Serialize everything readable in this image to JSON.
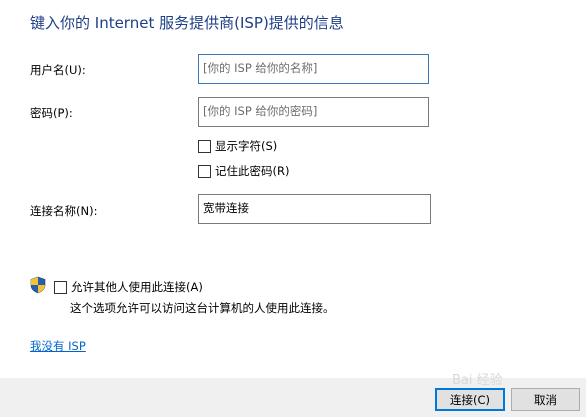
{
  "header": {
    "title": "键入你的 Internet 服务提供商(ISP)提供的信息"
  },
  "form": {
    "username_label": "用户名(U):",
    "username_placeholder": "[你的 ISP 给你的名称]",
    "password_label": "密码(P):",
    "password_placeholder": "[你的 ISP 给你的密码]",
    "show_chars_label": "显示字符(S)",
    "remember_password_label": "记住此密码(R)",
    "connection_name_label": "连接名称(N):",
    "connection_name_value": "宽带连接"
  },
  "sharing": {
    "shield_icon": "uac-shield-icon",
    "allow_others_label": "允许其他人使用此连接(A)",
    "allow_others_description": "这个选项允许可以访问这台计算机的人使用此连接。"
  },
  "links": {
    "no_isp": "我没有 ISP"
  },
  "footer": {
    "connect_label": "连接(C)",
    "cancel_label": "取消"
  },
  "watermark": {
    "text": "Bai 经验"
  },
  "colors": {
    "title": "#1e3f87",
    "link": "#0066cc",
    "focus_border": "#3c78b4",
    "default_button_border": "#0078d7",
    "footer_bg": "#f0f0f0"
  }
}
